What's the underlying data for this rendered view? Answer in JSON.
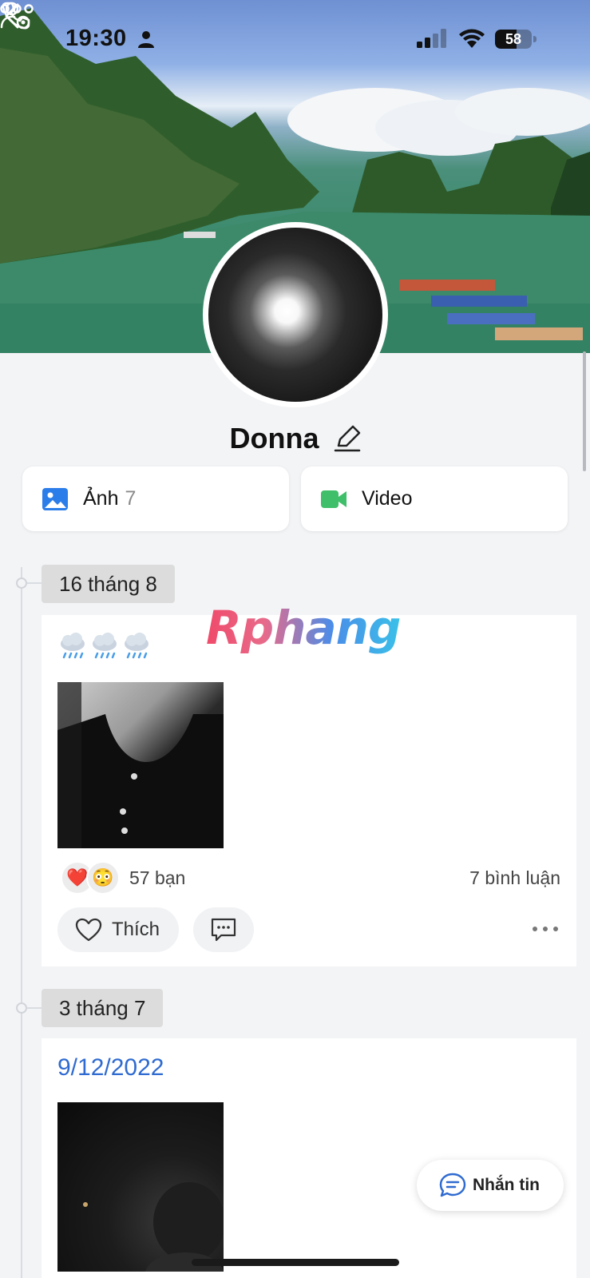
{
  "status_bar": {
    "time": "19:30",
    "battery": "58",
    "battery_level": 0.58
  },
  "profile": {
    "name": "Donna"
  },
  "media": {
    "photos_label": "Ảnh",
    "photos_count": "7",
    "videos_label": "Video"
  },
  "posts": [
    {
      "date_tag": "16 tháng 8",
      "emoji_text": "🌧️🌧️🌧️",
      "reactions": [
        "❤️",
        "😳"
      ],
      "reaction_count": "57 bạn",
      "comment_count": "7 bình luận",
      "like_label": "Thích"
    },
    {
      "date_tag": "3 tháng 7",
      "text": "9/12/2022"
    }
  ],
  "watermark": "Rphang",
  "chat_button": {
    "label": "Nhắn tin"
  },
  "colors": {
    "accent_blue": "#2f6bd0",
    "video_green": "#3fbf6a",
    "photo_blue": "#2b7de9"
  }
}
